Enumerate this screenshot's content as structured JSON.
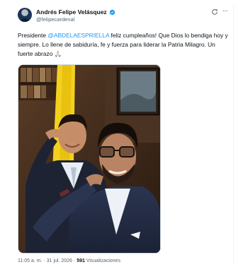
{
  "author": {
    "display_name": "Andrés Felipe Velásquez",
    "handle": "@felipecardenal",
    "verified_color": "#1d9bf0"
  },
  "tweet": {
    "text_prefix": "Presidente ",
    "mention": "@ABDELAESPRIELLA",
    "text_suffix": " feliz cumpleaños! Que Dios lo bendiga hoy y siempre. Lo llene de sabiduría, fe y fuerza para liderar la Patria Milagro. Un fuerte abrazo 🙏🏻",
    "image_alt": "Selfie de dos hombres haciendo un saludo militar frente a una bandera de Colombia"
  },
  "footer": {
    "time": "11:05 a. m.",
    "separator": " · ",
    "date": "31 jul. 2026",
    "views_count": "591",
    "views_label": " Visualizaciones"
  },
  "colors": {
    "link": "#1d9bf0",
    "text_primary": "#0f1419",
    "text_secondary": "#536471"
  },
  "icons": {
    "verified": "verified-badge-icon",
    "grok": "grok-icon",
    "more": "more-options-icon"
  }
}
